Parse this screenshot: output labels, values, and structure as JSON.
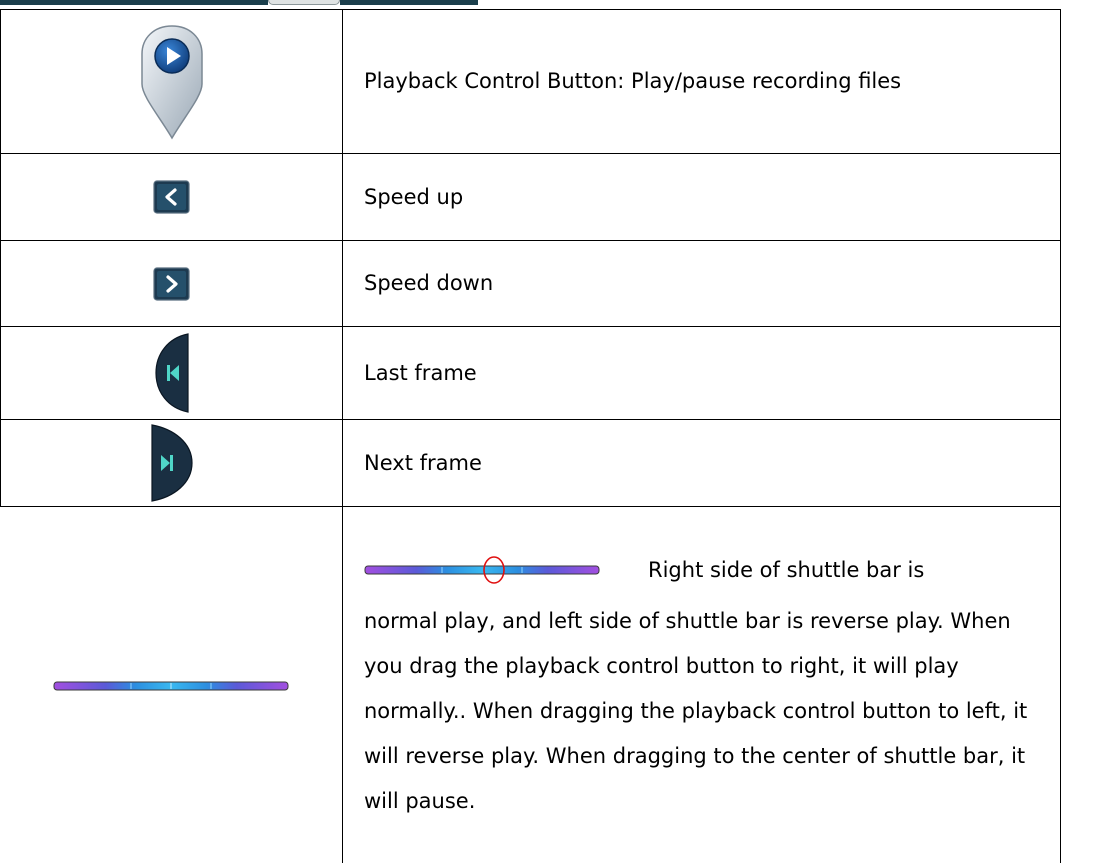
{
  "rows": [
    {
      "icon": "playback-control-pin-icon",
      "description": "Playback Control Button: Play/pause recording files"
    },
    {
      "icon": "chevron-left-icon",
      "description": "Speed up"
    },
    {
      "icon": "chevron-right-icon",
      "description": "Speed down"
    },
    {
      "icon": "last-frame-icon",
      "description": "Last frame"
    },
    {
      "icon": "next-frame-icon",
      "description": "Next frame"
    },
    {
      "icon": "shuttle-bar-icon",
      "description_first_line": "Right side of shuttle bar is",
      "description_rest": "normal play, and left side of shuttle bar is reverse play. When you drag the playback control button to right, it will play normally.. When dragging the playback control button to left, it will reverse play. When dragging to the center of shuttle bar, it will pause."
    }
  ],
  "colors": {
    "header_strip": "#1b3f4c",
    "button_dark": "#1d3a50",
    "icon_accent": "#4fd6c8",
    "shuttle_purple": "#a24fe0",
    "shuttle_blue": "#2c8fe0",
    "highlight_ring": "#e01010"
  }
}
